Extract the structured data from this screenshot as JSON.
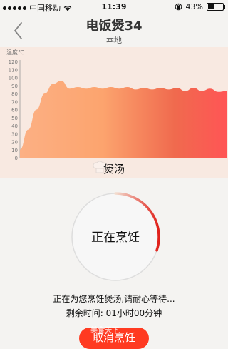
{
  "status_bar": {
    "carrier": "中国移动",
    "time": "11:39",
    "battery_percent": "43%",
    "battery_level": 0.43,
    "icons": [
      "signal-dots-icon",
      "wifi-icon",
      "rotation-lock-icon",
      "battery-icon"
    ]
  },
  "header": {
    "title": "电饭煲34",
    "subtitle": "本地",
    "back_icon": "chevron-left-icon"
  },
  "chart_data": {
    "type": "area",
    "ylabel": "温度℃",
    "yticks": [
      0,
      10,
      20,
      30,
      40,
      50,
      60,
      70,
      80,
      90,
      100,
      110,
      120
    ],
    "ylim": [
      0,
      120
    ],
    "xlim": [
      0,
      100
    ],
    "x": [
      0,
      4,
      8,
      12,
      16,
      20,
      24,
      28,
      32,
      36,
      40,
      44,
      48,
      52,
      56,
      60,
      64,
      68,
      72,
      76,
      80,
      84,
      88,
      92,
      96,
      100
    ],
    "values": [
      10,
      35,
      60,
      80,
      92,
      96,
      86,
      88,
      86,
      88,
      86,
      88,
      86,
      88,
      85,
      87,
      85,
      87,
      85,
      87,
      83,
      87,
      83,
      86,
      82,
      83
    ],
    "title": "煲汤",
    "grid": false,
    "colors": [
      "#fcb084",
      "#fca46e",
      "#f06a4e",
      "#ff5555"
    ]
  },
  "cooking": {
    "status": "正在烹饪",
    "progress": 0.3,
    "ring_color": "#e0201a",
    "message": "正在为您烹饪煲汤,请耐心等待...",
    "remaining": "剩余时间:  01小时00分钟"
  },
  "actions": {
    "cancel_label": "取消烹饪",
    "cancel_color": "#ff3a21",
    "watermark": "美食天下"
  }
}
